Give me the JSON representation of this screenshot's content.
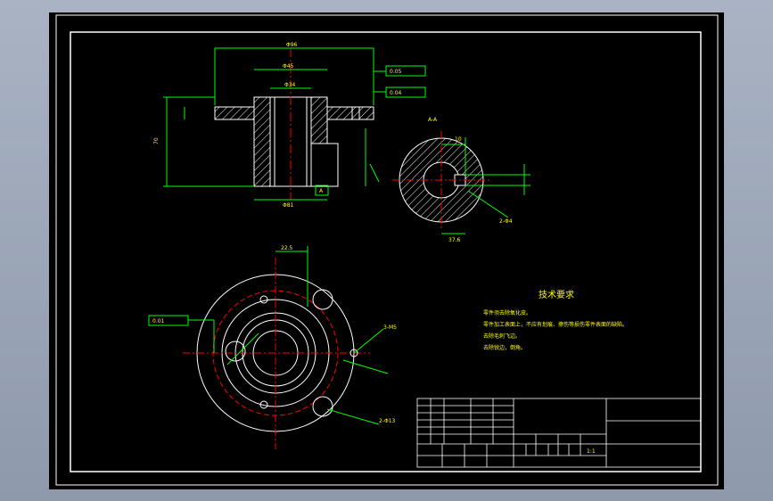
{
  "drawing": {
    "tech_title": "技术要求",
    "notes": [
      "零件须去除氧化皮。",
      "零件加工表面上，不应有划痕、擦伤等损伤零件表面的缺陷。",
      "去除毛刺飞边。",
      "去除锐边，倒角。"
    ],
    "scale": "1:1",
    "section_label": "A",
    "section_view_label": "A-A"
  },
  "colors": {
    "background": "#000000",
    "outline": "#ffffff",
    "dimension": "#00ff00",
    "center_line": "#ff0000",
    "text": "#ffff00",
    "hatch": "#00ffff",
    "frame": "#ffffff"
  }
}
